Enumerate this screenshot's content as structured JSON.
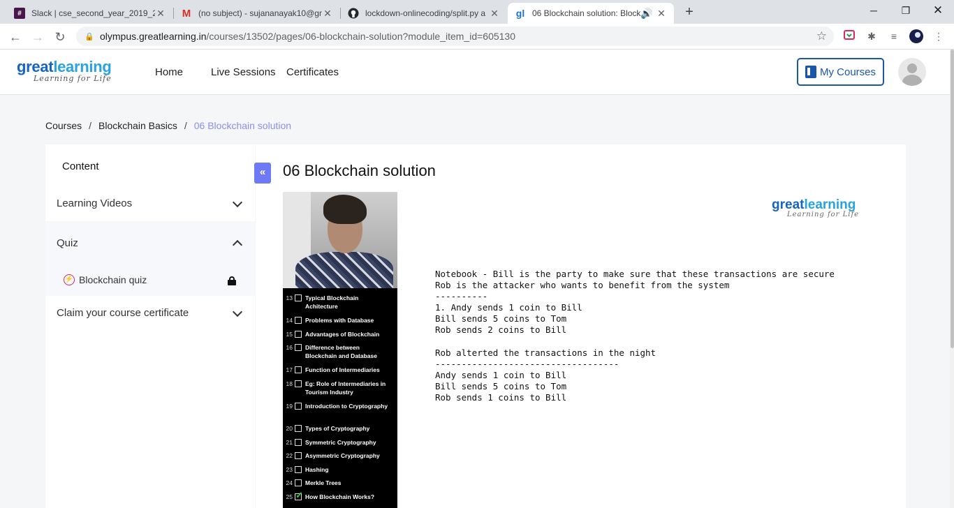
{
  "browser": {
    "tabs": [
      {
        "title": "Slack | cse_second_year_2019_20",
        "icon": "slack-icon"
      },
      {
        "title": "(no subject) - sujananayak10@gm",
        "icon": "gmail-icon"
      },
      {
        "title": "lockdown-onlinecoding/split.py a",
        "icon": "github-icon"
      },
      {
        "title": "06 Blockchain solution: Block",
        "icon": "greatlearning-icon"
      }
    ],
    "url_host": "olympus.greatlearning.in",
    "url_path": "/courses/13502/pages/06-blockchain-solution?module_item_id=605130"
  },
  "header": {
    "logo_part1": "great",
    "logo_part2": "learning",
    "logo_tagline": "Learning for Life",
    "nav": [
      "Home",
      "Live Sessions",
      "Certificates"
    ],
    "my_courses": "My Courses"
  },
  "breadcrumb": {
    "items": [
      "Courses",
      "Blockchain Basics",
      "06 Blockchain solution"
    ],
    "separator": "/"
  },
  "sidebar": {
    "title": "Content",
    "sections": [
      {
        "label": "Learning Videos",
        "expanded": false
      },
      {
        "label": "Quiz",
        "expanded": true
      },
      {
        "label": "Claim your course certificate",
        "expanded": false
      }
    ],
    "quiz_item": "Blockchain quiz"
  },
  "main": {
    "collapse_glyph": "«",
    "title": "06 Blockchain solution",
    "slide": {
      "logo_part1": "great",
      "logo_part2": "learning",
      "logo_tagline": "Learning for Life",
      "toc": [
        {
          "num": "13",
          "text": "Typical Blockchain Achitecture",
          "done": false
        },
        {
          "num": "14",
          "text": "Problems with Database",
          "done": false
        },
        {
          "num": "15",
          "text": "Advantages of Blockchain",
          "done": false
        },
        {
          "num": "16",
          "text": "Difference between Blockchain and Database",
          "done": false
        },
        {
          "num": "17",
          "text": "Function of Intermediaries",
          "done": false
        },
        {
          "num": "18",
          "text": "Eg: Role of Intermediaries in Tourism Industry",
          "done": false
        },
        {
          "num": "19",
          "text": "Introduction to Cryptography",
          "done": false
        },
        {
          "num": "20",
          "text": "Types of Cryptography",
          "done": false
        },
        {
          "num": "21",
          "text": "Symmetric Cryptography",
          "done": false
        },
        {
          "num": "22",
          "text": "Asymmetric Cryptography",
          "done": false
        },
        {
          "num": "23",
          "text": "Hashing",
          "done": false
        },
        {
          "num": "24",
          "text": "Merkle Trees",
          "done": false
        },
        {
          "num": "25",
          "text": "How Blockchain Works?",
          "done": true
        }
      ],
      "notebook_lines": [
        "Notebook - Bill is the party to make sure that these transactions are secure",
        "Rob is the attacker who wants to benefit from the system",
        "----------",
        "1. Andy sends 1 coin to Bill",
        "Bill sends 5 coins to Tom",
        "Rob sends 2 coins to Bill",
        "",
        "Rob alterted the transactions in the night",
        "-----------------------------------",
        "Andy sends 1 coin to Bill",
        "Bill sends 5 coins to Tom",
        "Rob sends 1 coins to Bill"
      ]
    }
  }
}
